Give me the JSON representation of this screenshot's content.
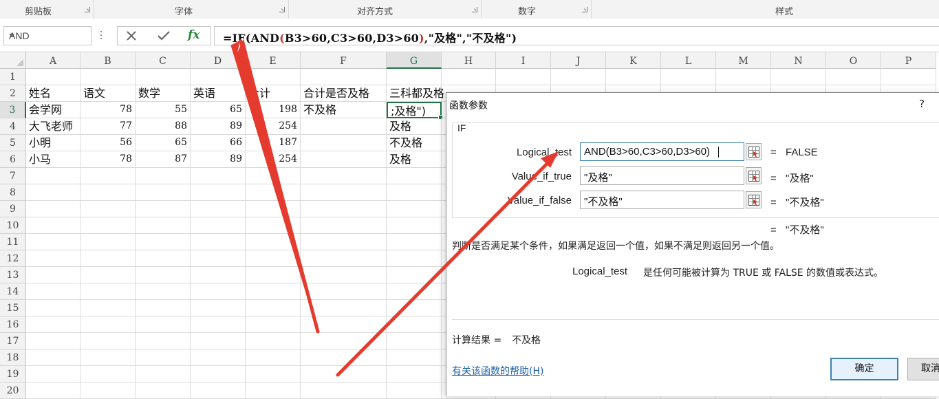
{
  "ribbon": {
    "groups": [
      {
        "label": "剪贴板"
      },
      {
        "label": "字体"
      },
      {
        "label": "对齐方式"
      },
      {
        "label": "数字"
      },
      {
        "label": "样式"
      }
    ]
  },
  "formula_bar": {
    "name_box": "AND",
    "cancel_icon": "close-icon",
    "confirm_icon": "check-icon",
    "fx_label": "fx",
    "formula_prefix": "=IF(AND",
    "formula_paren": "(",
    "formula_args": "B3>60,C3>60,D3>60",
    "formula_paren_close": ")",
    "formula_suffix": ",\"及格\",\"不及格\")"
  },
  "sheet": {
    "columns": [
      "A",
      "B",
      "C",
      "D",
      "E",
      "F",
      "G",
      "H",
      "I",
      "J",
      "K",
      "L",
      "M",
      "N",
      "O",
      "P"
    ],
    "selected_column": "G",
    "rows": [
      "1",
      "2",
      "3",
      "4",
      "5",
      "6",
      "7",
      "8",
      "9",
      "10",
      "11",
      "12",
      "13",
      "14",
      "15",
      "16",
      "17",
      "18",
      "19",
      "20"
    ],
    "selected_row": "3",
    "headers": [
      "姓名",
      "语文",
      "数学",
      "英语",
      "合计",
      "合计是否及格",
      "三科都及格"
    ],
    "data": [
      {
        "name": "会学网",
        "chinese": "78",
        "math": "55",
        "english": "65",
        "total": "198",
        "total_pass": "不及格",
        "all_pass": ";及格\")"
      },
      {
        "name": "大飞老师",
        "chinese": "77",
        "math": "88",
        "english": "89",
        "total": "254",
        "total_pass": "",
        "all_pass": "及格"
      },
      {
        "name": "小明",
        "chinese": "56",
        "math": "65",
        "english": "66",
        "total": "187",
        "total_pass": "",
        "all_pass": "不及格"
      },
      {
        "name": "小马",
        "chinese": "78",
        "math": "87",
        "english": "89",
        "total": "254",
        "total_pass": "",
        "all_pass": "及格"
      }
    ]
  },
  "dialog": {
    "title": "函数参数",
    "help_glyph": "?",
    "function_name": "IF",
    "args": [
      {
        "label": "Logical_test",
        "value": "AND(B3>60,C3>60,D3>60)",
        "result": "FALSE"
      },
      {
        "label": "Value_if_true",
        "value": "\"及格\"",
        "result": "\"及格\""
      },
      {
        "label": "Value_if_false",
        "value": "\"不及格\"",
        "result": "\"不及格\""
      }
    ],
    "eq_sign": "=",
    "overall_result": "\"不及格\"",
    "description": "判断是否满足某个条件，如果满足返回一个值，如果不满足则返回另一个值。",
    "arg_help_name": "Logical_test",
    "arg_help_text": "是任何可能被计算为 TRUE 或 FALSE 的数值或表达式。",
    "calc_result_label": "计算结果 =",
    "calc_result_value": "不及格",
    "help_link": "有关该函数的帮助(H)",
    "ok_label": "确定",
    "cancel_label": "取消"
  },
  "colors": {
    "excel_green": "#217346",
    "annotation_arrow": "#e53b2e",
    "link_blue": "#1a5fa8"
  }
}
